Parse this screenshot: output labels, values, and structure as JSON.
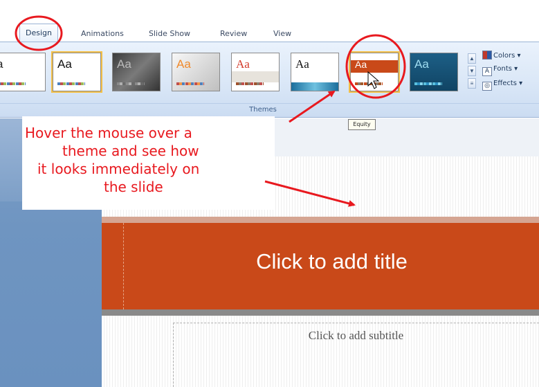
{
  "ribbon": {
    "tabs": [
      {
        "label": "Design",
        "active": true
      },
      {
        "label": "Animations",
        "active": false
      },
      {
        "label": "Slide Show",
        "active": false
      },
      {
        "label": "Review",
        "active": false
      },
      {
        "label": "View",
        "active": false
      }
    ],
    "group_label": "Themes",
    "themes": [
      {
        "name": "partial-theme",
        "preview_text": "a"
      },
      {
        "name": "office-theme",
        "preview_text": "Aa"
      },
      {
        "name": "dark-theme",
        "preview_text": "Aa"
      },
      {
        "name": "gray-theme",
        "preview_text": "Aa"
      },
      {
        "name": "red-serif-theme",
        "preview_text": "Aa"
      },
      {
        "name": "wave-theme",
        "preview_text": "Aa"
      },
      {
        "name": "equity-theme",
        "preview_text": "Aa"
      },
      {
        "name": "teal-theme",
        "preview_text": "Aa"
      }
    ],
    "side_commands": {
      "colors": "Colors",
      "fonts": "Fonts",
      "effects": "Effects"
    },
    "tooltip": "Equity"
  },
  "callout": {
    "lines": [
      "Hover the mouse over a",
      "theme  and see how",
      "it looks immediately on",
      "the slide"
    ]
  },
  "slide": {
    "title_placeholder": "Click to add title",
    "subtitle_placeholder": "Click to add subtitle"
  },
  "colors": {
    "annotation": "#e8191f",
    "title_band": "#c94919",
    "hover_highlight": "#f4c048"
  }
}
